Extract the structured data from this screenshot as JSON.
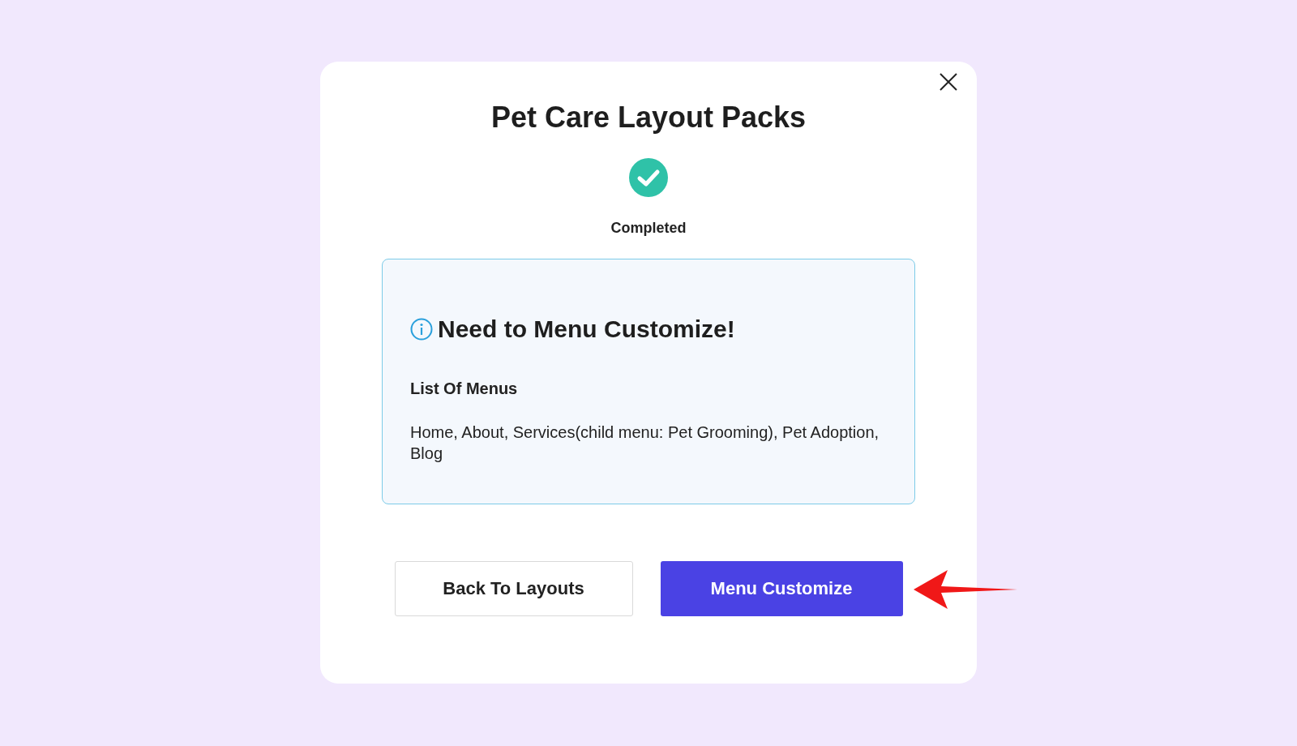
{
  "dialog": {
    "title": "Pet Care Layout Packs",
    "status": "Completed",
    "notice": {
      "heading": "Need to Menu Customize!",
      "subheading": "List Of Menus",
      "body": "Home, About, Services(child menu: Pet Grooming), Pet Adoption, Blog"
    },
    "buttons": [
      {
        "kind": "secondary",
        "label": "Back To Layouts"
      },
      {
        "kind": "primary",
        "label": "Menu Customize"
      }
    ]
  }
}
